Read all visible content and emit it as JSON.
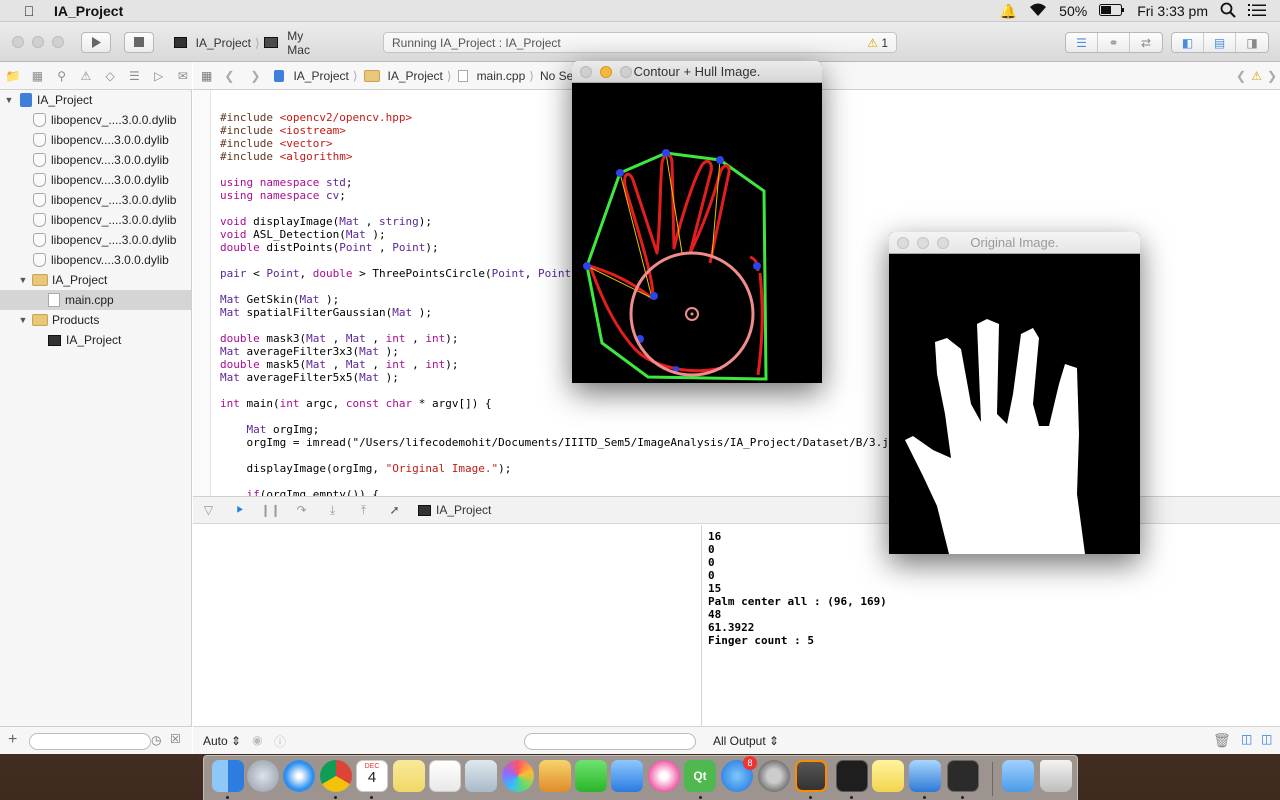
{
  "menubar": {
    "app_name": "IA_Project",
    "battery": "50%",
    "clock": "Fri 3:33 pm"
  },
  "toolbar": {
    "scheme_project": "IA_Project",
    "scheme_device": "My Mac",
    "status_text": "Running IA_Project : IA_Project",
    "warning_count": "1"
  },
  "navigator": {
    "project": "IA_Project",
    "libraries": [
      "libopencv_....3.0.0.dylib",
      "libopencv....3.0.0.dylib",
      "libopencv....3.0.0.dylib",
      "libopencv....3.0.0.dylib",
      "libopencv_....3.0.0.dylib",
      "libopencv_....3.0.0.dylib",
      "libopencv_....3.0.0.dylib",
      "libopencv....3.0.0.dylib"
    ],
    "group": "IA_Project",
    "file": "main.cpp",
    "products_group": "Products",
    "product": "IA_Project"
  },
  "jumpbar": {
    "crumb1": "IA_Project",
    "crumb2": "IA_Project",
    "crumb3": "main.cpp",
    "crumb4": "No Sele"
  },
  "editor": {
    "lines": [
      {
        "c": "pp",
        "t": "#include <opencv2/opencv.hpp>"
      },
      {
        "c": "pp",
        "t": "#include <iostream>"
      },
      {
        "c": "pp",
        "t": "#include <vector>"
      },
      {
        "c": "pp",
        "t": "#include <algorithm>"
      },
      {
        "c": "",
        "t": ""
      },
      {
        "c": "",
        "t": "using namespace std;"
      },
      {
        "c": "",
        "t": "using namespace cv;"
      },
      {
        "c": "",
        "t": ""
      },
      {
        "c": "",
        "t": "void displayImage(Mat , string);"
      },
      {
        "c": "",
        "t": "void ASL_Detection(Mat );"
      },
      {
        "c": "",
        "t": "double distPoints(Point , Point);"
      },
      {
        "c": "",
        "t": ""
      },
      {
        "c": "",
        "t": "pair < Point, double > ThreePointsCircle(Point, Point"
      },
      {
        "c": "",
        "t": ""
      },
      {
        "c": "",
        "t": "Mat GetSkin(Mat );"
      },
      {
        "c": "",
        "t": "Mat spatialFilterGaussian(Mat );"
      },
      {
        "c": "",
        "t": ""
      },
      {
        "c": "",
        "t": "double mask3(Mat , Mat , int , int);"
      },
      {
        "c": "",
        "t": "Mat averageFilter3x3(Mat );"
      },
      {
        "c": "",
        "t": "double mask5(Mat , Mat , int , int);"
      },
      {
        "c": "",
        "t": "Mat averageFilter5x5(Mat );"
      },
      {
        "c": "",
        "t": ""
      },
      {
        "c": "",
        "t": "int main(int argc, const char * argv[]) {"
      },
      {
        "c": "",
        "t": ""
      },
      {
        "c": "",
        "t": "    Mat orgImg;"
      },
      {
        "c": "",
        "t": "    orgImg = imread(\"/Users/lifecodemohit/Documents/IIITD_Sem5/ImageAnalysis/IA_Project/Dataset/B/3.j"
      },
      {
        "c": "",
        "t": ""
      },
      {
        "c": "",
        "t": "    displayImage(orgImg, \"Original Image.\");"
      },
      {
        "c": "",
        "t": ""
      },
      {
        "c": "",
        "t": "    if(orgImg.empty()) {"
      }
    ]
  },
  "debug": {
    "target": "IA_Project",
    "auto_label": "Auto",
    "output_label": "All Output"
  },
  "console": {
    "lines": [
      "16",
      "0",
      "0",
      "0",
      "15",
      "Palm center all : (96, 169)",
      "48",
      "61.3922",
      "Finger count : 5"
    ]
  },
  "windows": {
    "contour_title": "Contour + Hull Image.",
    "original_title": "Original Image."
  },
  "dock": {
    "calendar_month": "DEC",
    "calendar_day": "4",
    "appstore_badge": "8"
  }
}
